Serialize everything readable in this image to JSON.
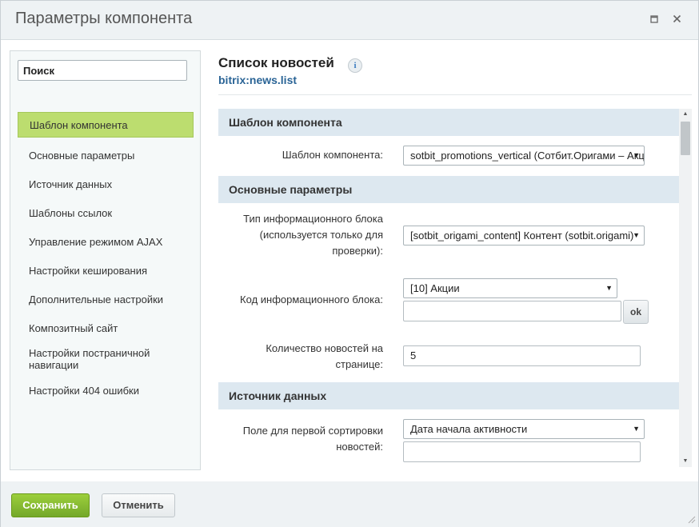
{
  "window": {
    "title": "Параметры компонента",
    "maximize_icon": "maximize-icon",
    "close_icon": "close-icon"
  },
  "sidebar": {
    "search_value": "Поиск",
    "items": [
      {
        "label": "Шаблон компонента",
        "active": true
      },
      {
        "label": "Основные параметры"
      },
      {
        "label": "Источник данных"
      },
      {
        "label": "Шаблоны ссылок"
      },
      {
        "label": "Управление режимом AJAX"
      },
      {
        "label": "Настройки кеширования"
      },
      {
        "label": "Дополнительные настройки"
      },
      {
        "label": "Композитный сайт"
      },
      {
        "label": "Настройки постраничной навигации"
      },
      {
        "label": "Настройки 404 ошибки"
      }
    ]
  },
  "component": {
    "title": "Список новостей",
    "code": "bitrix:news.list",
    "info_icon": "i"
  },
  "params": {
    "sections": {
      "template": "Шаблон компонента",
      "main": "Основные параметры",
      "source": "Источник данных"
    },
    "template_label": "Шаблон компонента:",
    "template_value": "sotbit_promotions_vertical (Сотбит.Оригами – Акции (вертикальный))",
    "iblock_type_label": "Тип информационного блока (используется только для проверки):",
    "iblock_type_value": "[sotbit_origami_content] Контент (sotbit.origami)",
    "iblock_code_label": "Код информационного блока:",
    "iblock_code_value": "[10] Акции",
    "iblock_code_input": "",
    "ok_label": "ok",
    "news_count_label": "Количество новостей на странице:",
    "news_count_value": "5",
    "sort_label": "Поле для первой сортировки новостей:",
    "sort_value": "Дата начала активности",
    "sort_input": ""
  },
  "footer": {
    "save_label": "Сохранить",
    "cancel_label": "Отменить"
  },
  "colors": {
    "save_button": "#86bb31",
    "active_nav": "#bcdd6f",
    "section_header": "#dde8f0",
    "code_link": "#2a6496"
  }
}
